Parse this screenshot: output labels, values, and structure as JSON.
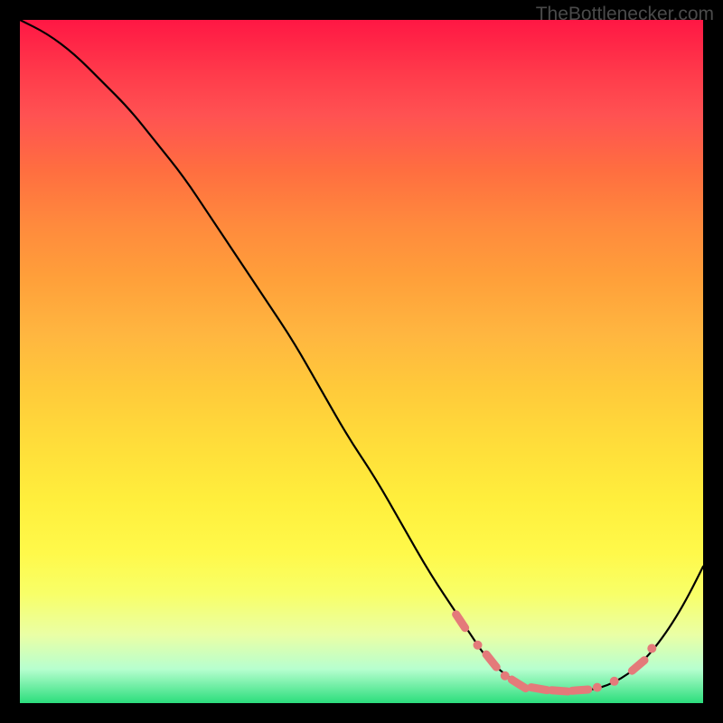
{
  "watermark": "TheBottlenecker.com",
  "chart_data": {
    "type": "line",
    "title": "",
    "xlabel": "",
    "ylabel": "",
    "xlim": [
      0,
      100
    ],
    "ylim": [
      0,
      100
    ],
    "series": [
      {
        "name": "curve",
        "color": "#000000",
        "x": [
          0,
          4,
          8,
          12,
          16,
          20,
          24,
          28,
          32,
          36,
          40,
          44,
          48,
          52,
          56,
          60,
          64,
          66,
          68,
          70,
          72,
          74,
          76,
          78,
          80,
          82,
          84,
          86,
          88,
          90,
          92,
          94,
          96,
          98,
          100
        ],
        "y": [
          100,
          98,
          95,
          91,
          87,
          82,
          77,
          71,
          65,
          59,
          53,
          46,
          39,
          33,
          26,
          19,
          13,
          10,
          7,
          5,
          3.5,
          2.5,
          2.0,
          1.8,
          1.7,
          1.8,
          2.0,
          2.6,
          3.6,
          5.0,
          7.0,
          9.5,
          12.5,
          16.0,
          20.0
        ]
      }
    ],
    "markers": [
      {
        "x": 64.5,
        "y": 12.0,
        "shape": "pill",
        "color": "#e47a7a"
      },
      {
        "x": 67.0,
        "y": 8.5,
        "shape": "dot",
        "color": "#e47a7a"
      },
      {
        "x": 69.0,
        "y": 6.2,
        "shape": "pill",
        "color": "#e47a7a"
      },
      {
        "x": 71.0,
        "y": 4.0,
        "shape": "dot",
        "color": "#e47a7a"
      },
      {
        "x": 73.0,
        "y": 2.8,
        "shape": "pill",
        "color": "#e47a7a"
      },
      {
        "x": 76.0,
        "y": 2.1,
        "shape": "pill",
        "color": "#e47a7a"
      },
      {
        "x": 79.0,
        "y": 1.8,
        "shape": "pill",
        "color": "#e47a7a"
      },
      {
        "x": 82.0,
        "y": 1.9,
        "shape": "pill",
        "color": "#e47a7a"
      },
      {
        "x": 84.5,
        "y": 2.3,
        "shape": "dot",
        "color": "#e47a7a"
      },
      {
        "x": 87.0,
        "y": 3.2,
        "shape": "dot",
        "color": "#e47a7a"
      },
      {
        "x": 90.5,
        "y": 5.5,
        "shape": "pill",
        "color": "#e47a7a"
      },
      {
        "x": 92.5,
        "y": 8.0,
        "shape": "dot",
        "color": "#e47a7a"
      }
    ]
  }
}
